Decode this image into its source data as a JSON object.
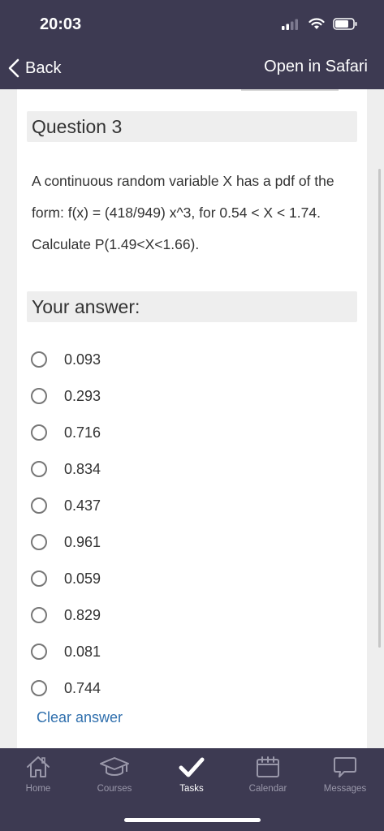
{
  "status_bar": {
    "time": "20:03"
  },
  "nav": {
    "back_label": "Back",
    "open_in_safari": "Open in Safari"
  },
  "question": {
    "title": "Question 3",
    "text": "A continuous random variable X has a pdf of the form: f(x) = (418/949) x^3, for 0.54 < X < 1.74. Calculate P(1.49<X<1.66).",
    "answer_heading": "Your answer:",
    "options": [
      "0.093",
      "0.293",
      "0.716",
      "0.834",
      "0.437",
      "0.961",
      "0.059",
      "0.829",
      "0.081",
      "0.744"
    ],
    "clear_label": "Clear answer"
  },
  "tabs": [
    {
      "label": "Home",
      "icon": "home-icon"
    },
    {
      "label": "Courses",
      "icon": "graduation-cap-icon"
    },
    {
      "label": "Tasks",
      "icon": "checkmark-icon",
      "active": true
    },
    {
      "label": "Calendar",
      "icon": "calendar-icon"
    },
    {
      "label": "Messages",
      "icon": "speech-bubble-icon"
    }
  ],
  "colors": {
    "header_bg": "#3d3a52",
    "link": "#2f6fad",
    "page_bg": "#eeeeee"
  }
}
